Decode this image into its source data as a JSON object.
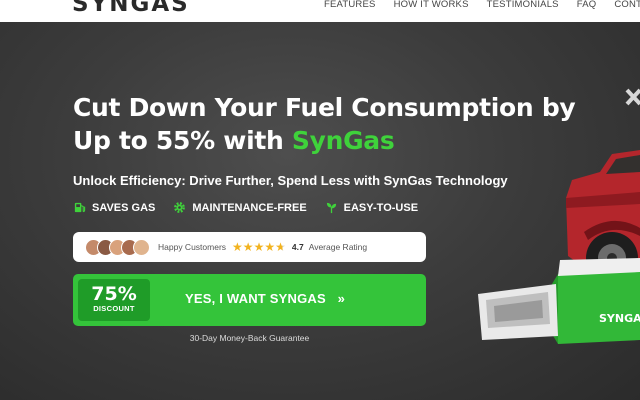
{
  "brand": {
    "logo": "SYNGAS"
  },
  "nav": {
    "links": [
      "FEATURES",
      "HOW IT WORKS",
      "TESTIMONIALS",
      "FAQ",
      "CONTACT"
    ]
  },
  "hero": {
    "headline_part1": "Cut Down Your Fuel Consumption by Up to 55% with ",
    "headline_accent": "SynGas",
    "subhead": "Unlock Efficiency: Drive Further, Spend Less with SynGas Technology",
    "features": [
      {
        "label": "SAVES GAS",
        "icon": "gas-pump-icon"
      },
      {
        "label": "MAINTENANCE-FREE",
        "icon": "gear-icon"
      },
      {
        "label": "EASY-TO-USE",
        "icon": "plant-icon"
      }
    ],
    "rating": {
      "label": "Happy Customers",
      "stars": 4.7,
      "score": "4.7",
      "suffix": "Average Rating"
    },
    "cta": {
      "discount": "75%",
      "discount_label": "DISCOUNT",
      "label": "YES, I WANT SYNGAS",
      "chevron": "»"
    },
    "guarantee": "30-Day Money-Back Guarantee",
    "device_label": "SYNGA"
  },
  "colors": {
    "accent": "#3fd23b",
    "button": "#34c43a",
    "button_dark": "#1f9c28",
    "hero_bg": "#3c3c3c",
    "star": "#f2b320"
  }
}
